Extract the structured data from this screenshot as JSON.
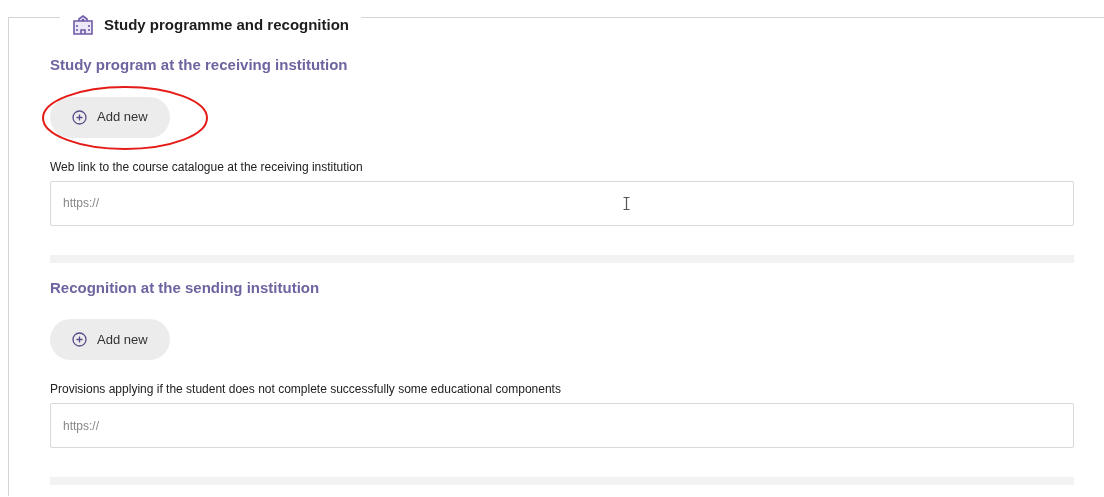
{
  "panel": {
    "title": "Study programme and recognition"
  },
  "sections": [
    {
      "heading": "Study program at the receiving institution",
      "add_button": "Add new",
      "highlighted": true,
      "field_label": "Web link to the course catalogue at the receiving institution",
      "placeholder": "https://",
      "text_cursor": true
    },
    {
      "heading": "Recognition at the sending institution",
      "add_button": "Add new",
      "highlighted": false,
      "field_label": "Provisions applying if the student does not complete successfully some educational components",
      "placeholder": "https://",
      "text_cursor": false
    }
  ]
}
